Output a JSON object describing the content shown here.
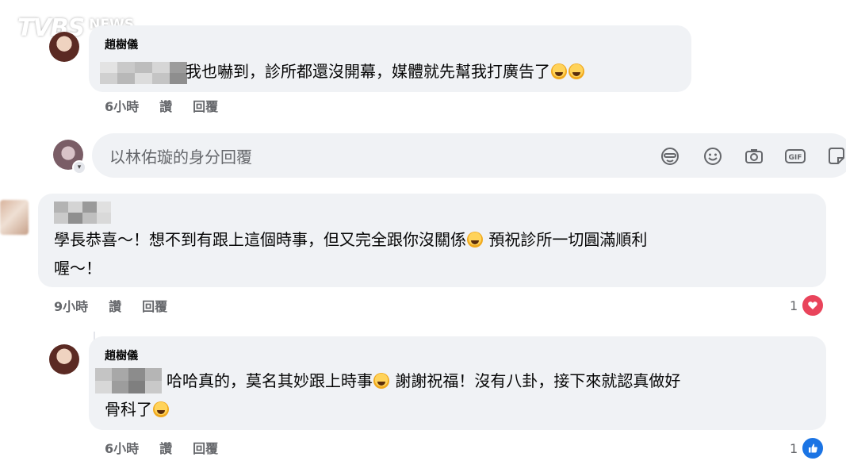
{
  "watermark": {
    "brand": "TVBS",
    "suffix": "NEWS"
  },
  "comment1": {
    "author": "趙樹儀",
    "text": "我也嚇到，診所都還沒開幕，媒體就先幫我打廣告了",
    "emoji": [
      "rolling-on-floor-laughing",
      "rolling-on-floor-laughing"
    ],
    "time": "6小時",
    "like_label": "讚",
    "reply_label": "回覆"
  },
  "reply_box": {
    "placeholder": "以林佑璇的身分回覆",
    "tools": [
      "avatar-sticker-icon",
      "emoji-icon",
      "camera-icon",
      "gif-icon",
      "sticker-icon"
    ]
  },
  "comment2": {
    "line1": "學長恭喜～！想不到有跟上這個時事，",
    "line1_tail": "但又完全跟你沒關係",
    "line1_end": "預祝診所一切圓滿順利",
    "line2": "喔～！",
    "time": "9小時",
    "like_label": "讚",
    "reply_label": "回覆",
    "reaction_count": "1",
    "reaction": "heart"
  },
  "comment3": {
    "author": "趙樹儀",
    "line1": "哈哈真的，莫名其妙跟上時事",
    "line1_tail": "謝謝祝福！沒有八卦，接下來就認真做好",
    "line2": "骨科了",
    "time": "6小時",
    "like_label": "讚",
    "reply_label": "回覆",
    "reaction_count": "1",
    "reaction": "like"
  },
  "colors": {
    "bubble": "#f0f2f5",
    "meta": "#65676b",
    "heart": "#e9445b",
    "like": "#1b74e4"
  }
}
